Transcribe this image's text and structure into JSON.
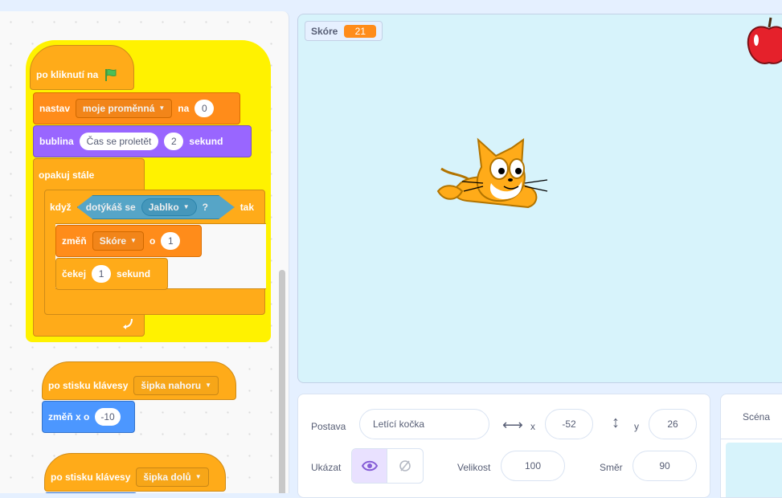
{
  "script": {
    "hat_flag_label": "po kliknutí na",
    "set_label": "nastav",
    "set_var": "moje proměnná",
    "set_to": "na",
    "set_value": "0",
    "say_label": "bublina",
    "say_text": "Čas se proletět",
    "say_secs": "2",
    "say_unit": "sekund",
    "forever_label": "opakuj stále",
    "if_label": "když",
    "if_then": "tak",
    "touching_label": "dotýkáš se",
    "touching_target": "Jablko",
    "touching_q": "?",
    "change_label": "změň",
    "change_var": "Skóre",
    "change_by": "o",
    "change_value": "1",
    "wait_label": "čekej",
    "wait_value": "1",
    "wait_unit": "sekund",
    "key_hat1_label": "po stisku klávesy",
    "key_hat1_key": "šipka nahoru",
    "move_x_label": "změň x o",
    "move_x_value": "-10",
    "key_hat2_label": "po stisku klávesy",
    "key_hat2_key": "šipka dolů"
  },
  "stage": {
    "monitor_label": "Skóre",
    "monitor_value": "21"
  },
  "sprite_info": {
    "sprite_label": "Postava",
    "sprite_name": "Letící kočka",
    "x_label": "x",
    "x_value": "-52",
    "y_label": "y",
    "y_value": "26",
    "show_label": "Ukázat",
    "size_label": "Velikost",
    "size_value": "100",
    "direction_label": "Směr",
    "direction_value": "90"
  },
  "stage_selector": {
    "title": "Scéna"
  },
  "colors": {
    "events": "#ffab19",
    "variables": "#ff8c1a",
    "looks": "#9966ff",
    "control": "#ffab19",
    "sensing": "#5cb1d6",
    "motion": "#4c97ff",
    "stage_bg": "#d7f3fb",
    "highlight": "#fff200"
  },
  "icons": [
    "green-flag-icon",
    "rotate-arrow-icon",
    "dropdown-caret-icon",
    "horizontal-arrows-icon",
    "vertical-arrows-icon",
    "eye-icon",
    "eye-hidden-icon",
    "cat-sprite-icon",
    "apple-sprite-icon"
  ]
}
